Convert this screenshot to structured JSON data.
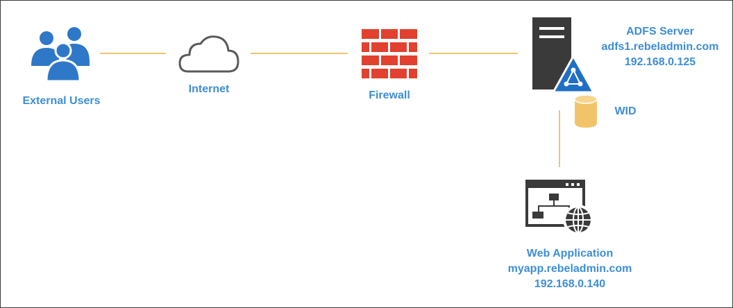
{
  "nodes": {
    "external_users": {
      "label": "External Users"
    },
    "internet": {
      "label": "Internet"
    },
    "firewall": {
      "label": "Firewall"
    },
    "adfs_server": {
      "lines": [
        "ADFS Server",
        "adfs1.rebeladmin.com",
        "192.168.0.125"
      ]
    },
    "wid": {
      "label": "WID"
    },
    "web_application": {
      "lines": [
        "Web Application",
        "myapp.rebeladmin.com",
        "192.168.0.140"
      ]
    }
  },
  "icons": {
    "users": "users-group-icon",
    "cloud": "cloud-icon",
    "firewall": "brick-wall-icon",
    "server": "server-icon",
    "adfs": "adfs-triangle-icon",
    "database": "database-cylinder-icon",
    "webapp": "web-application-icon"
  },
  "colors": {
    "label": "#3d8ed6",
    "connector": "#f2c46a",
    "users": "#2e78c7",
    "firewall": "#e1412e",
    "server": "#3a3a3a",
    "adfs_badge": "#1f6fc4",
    "database": "#f2c46a"
  }
}
